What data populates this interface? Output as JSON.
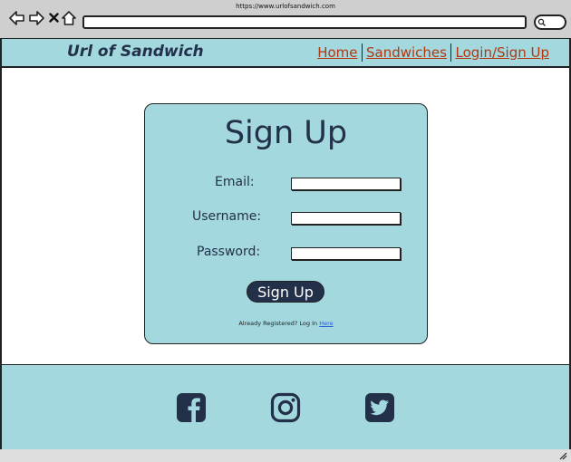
{
  "browser": {
    "url": "https://www.urlofsandwich.com",
    "icons": [
      "back-arrow-icon",
      "forward-arrow-icon",
      "close-icon",
      "home-icon",
      "search-icon"
    ]
  },
  "header": {
    "brand": "Url of Sandwich",
    "nav": [
      {
        "label": "Home"
      },
      {
        "label": "Sandwiches"
      },
      {
        "label": "Login/Sign Up"
      }
    ]
  },
  "signup": {
    "title": "Sign Up",
    "email_label": "Email:",
    "username_label": "Username:",
    "password_label": "Password:",
    "button_label": "Sign Up",
    "already_text": "Already Registered? Log In",
    "here_link": "Here"
  },
  "footer": {
    "social": [
      "facebook-icon",
      "instagram-icon",
      "twitter-icon"
    ]
  },
  "colors": {
    "accent": "#a3d8df",
    "dark": "#23304a",
    "link": "#b3370f"
  }
}
